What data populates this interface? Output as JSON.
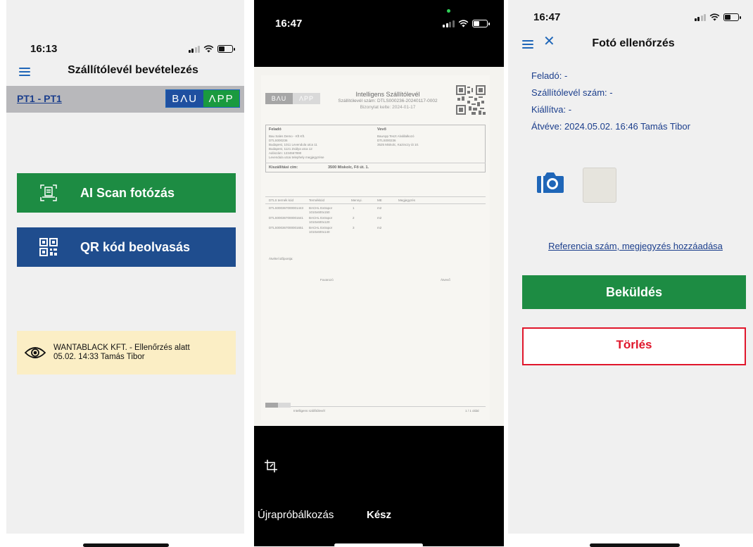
{
  "screen1": {
    "time": "16:13",
    "title": "Szállítólevél bevételezés",
    "project_link": "PT1 - PT1",
    "logo": {
      "left": "BΛU",
      "right": "ΛPP"
    },
    "ai_scan_label": "AI Scan fotózás",
    "qr_label": "QR kód beolvasás",
    "notice": {
      "line1": "WANTABLACK KFT. - Ellenőrzés alatt",
      "line2": "05.02. 14:33 Tamás Tibor"
    }
  },
  "screen2": {
    "time": "16:47",
    "document": {
      "logo_left": "BΛU",
      "logo_right": "ΛPP",
      "title": "Intelligens Szállítólevél",
      "number_line": "Szállítólevél szám: DTLS000236-20240117-0002",
      "date_line": "Bizonylat kelte: 2024-01-17",
      "sender_label": "Feladó",
      "sender_lines": [
        "Bau Sales Demo - Kft Kft.",
        "DTLS000236",
        "Budapest, 1011 Levendula utca 11",
        "Budapest, 1121 Zsálya utca 12",
        "Adószám: 1234567890",
        "Levendula utcai telephely megjegyzése"
      ],
      "buyer_label": "Vevő",
      "buyer_lines": [
        "BauApp Teszt Alvállalkozó",
        "DTLS000236",
        "3525 Miskolc, Kazinczy út 10."
      ],
      "delivery_label": "Kiszállítási cím:",
      "delivery_value": "3500 Miskolc, Fő út. 1.",
      "table_headers": [
        "DTLS termék kód",
        "Termékkód",
        "Mennyi.",
        "ME",
        "Megjegyzés"
      ],
      "table_rows": [
        [
          "DTLS000367000001443",
          "BACHL Extrapor 1010x600x150",
          "1",
          "m2"
        ],
        [
          "DTLS000367000001641",
          "BACHL Extrapor 1010x600x120",
          "2",
          "m2"
        ],
        [
          "DTLS000367000001651",
          "BACHL Extrapor 1010x600x140",
          "3",
          "m2"
        ]
      ],
      "receipt_label": "Átvétel időpontja:",
      "sign_left": "Fuvarozó",
      "sign_right": "Átvevő",
      "footer_text": "Intelligens szállítólevél",
      "page_text": "1 / 1 oldal"
    },
    "retry_label": "Újrapróbálkozás",
    "done_label": "Kész"
  },
  "screen3": {
    "time": "16:47",
    "title": "Fotó ellenőrzés",
    "sender": "Feladó: -",
    "delivery_number": "Szállítólevél szám: -",
    "issued": "Kiállítva: -",
    "received": "Átvéve: 2024.05.02. 16:46 Tamás Tibor",
    "reference_link": "Referencia szám, megjegyzés hozzáadása",
    "send_label": "Beküldés",
    "delete_label": "Törlés"
  },
  "colors": {
    "green": "#1d8c43",
    "navy": "#1f4d8e",
    "link_blue": "#1b3e8c",
    "icon_blue": "#1f66b8",
    "notice_bg": "#fbeec5",
    "delete_red": "#e0162b"
  },
  "icons": [
    "hamburger-icon",
    "document-scan-icon",
    "qr-code-icon",
    "eye-icon",
    "crop-icon",
    "close-icon",
    "camera-icon",
    "signal-icon",
    "wifi-icon",
    "battery-icon"
  ]
}
